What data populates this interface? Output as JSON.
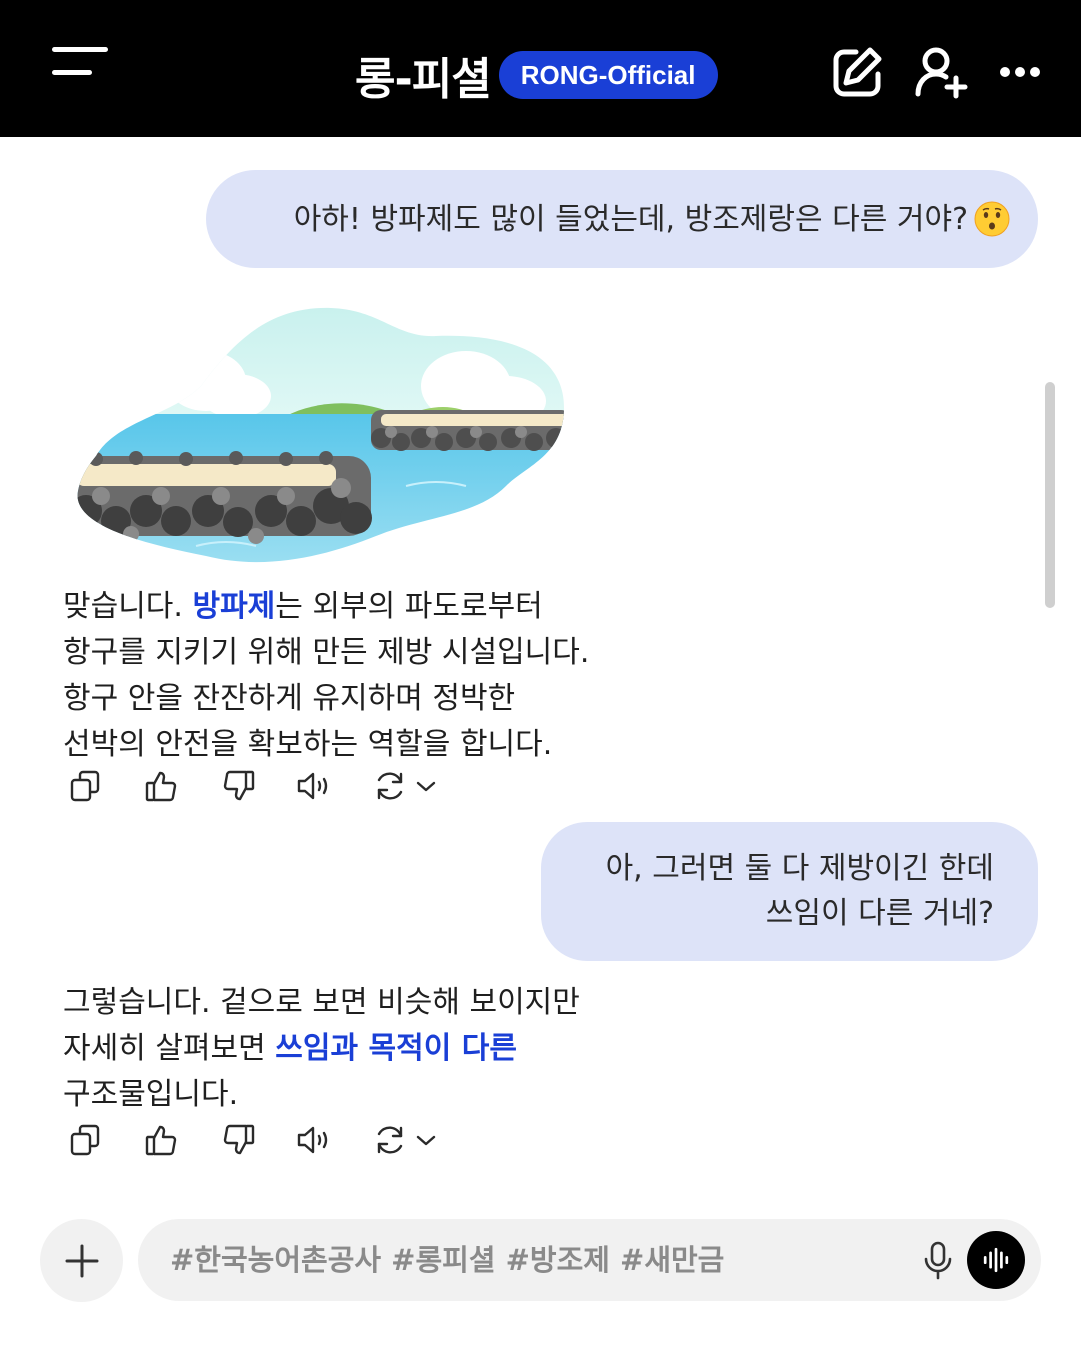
{
  "header": {
    "title": "롱-피셜",
    "badge": "RONG-Official",
    "icons": [
      "menu-icon",
      "edit-icon",
      "add-user-icon",
      "more-icon"
    ]
  },
  "messages": {
    "user1": "아하! 방파제도 많이 들었는데, 방조제랑은 다른 거야?",
    "user1_emoji": "hushed-face-emoji",
    "bot1": {
      "lines": [
        {
          "pre": "맞습니다. ",
          "hl": "방파제",
          "post": "는 외부의 파도로부터"
        },
        {
          "pre": "항구를 지키기 위해 만든 제방 시설입니다.",
          "hl": "",
          "post": ""
        },
        {
          "pre": "항구 안을 잔잔하게 유지하며 정박한",
          "hl": "",
          "post": ""
        },
        {
          "pre": "선박의 안전을 확보하는 역할을 합니다.",
          "hl": "",
          "post": ""
        }
      ]
    },
    "user2": {
      "line1": "아, 그러면 둘 다 제방이긴 한데",
      "line2": "쓰임이 다른 거네?"
    },
    "bot2": {
      "lines": [
        {
          "pre": "그렇습니다. 겉으로 보면 비슷해 보이지만",
          "hl": "",
          "post": ""
        },
        {
          "pre": "자세히 살펴보면 ",
          "hl": "쓰임과 목적이 다른",
          "post": ""
        },
        {
          "pre": "구조물입니다.",
          "hl": "",
          "post": ""
        }
      ]
    }
  },
  "actions": [
    "copy-icon",
    "thumbs-up-icon",
    "thumbs-down-icon",
    "speaker-icon",
    "regenerate-icon",
    "chevron-down-icon"
  ],
  "composer": {
    "placeholder": "#한국농어촌공사 #롱피셜 #방조제 #새만금",
    "icons": [
      "plus-icon",
      "mic-icon",
      "voice-wave-icon"
    ]
  },
  "colors": {
    "header_bg": "#000000",
    "accent": "#1a3fd6",
    "user_bubble": "#dde3f8",
    "composer_bg": "#f1f1f1"
  }
}
